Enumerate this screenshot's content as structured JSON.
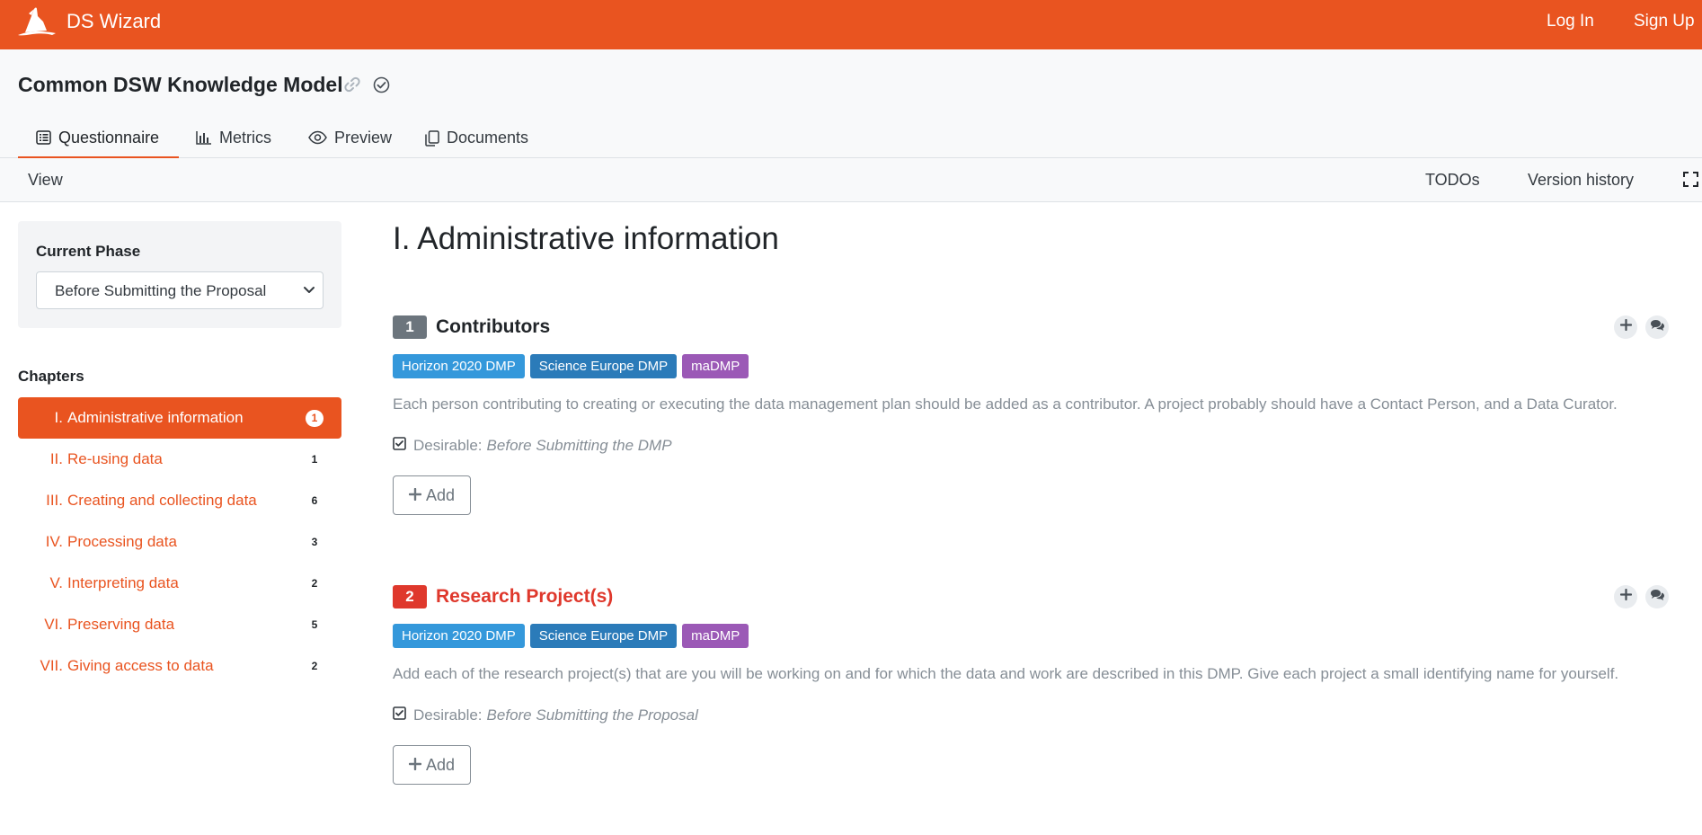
{
  "brand": {
    "name": "DS Wizard"
  },
  "nav": {
    "login": "Log In",
    "signup": "Sign Up"
  },
  "project": {
    "title": "Common DSW Knowledge Model"
  },
  "tabs": [
    {
      "label": "Questionnaire",
      "icon": "list-icon",
      "active": true
    },
    {
      "label": "Metrics",
      "icon": "bar-chart-icon"
    },
    {
      "label": "Preview",
      "icon": "eye-icon"
    },
    {
      "label": "Documents",
      "icon": "copy-icon"
    }
  ],
  "toolbar": {
    "view": "View",
    "todos": "TODOs",
    "version_history": "Version history",
    "fullscreen_icon": "expand-icon"
  },
  "phase": {
    "label": "Current Phase",
    "selected": "Before Submitting the Proposal"
  },
  "chapters": {
    "heading": "Chapters",
    "items": [
      {
        "num": "I.",
        "label": "Administrative information",
        "count": "1",
        "active": true
      },
      {
        "num": "II.",
        "label": "Re-using data",
        "count": "1"
      },
      {
        "num": "III.",
        "label": "Creating and collecting data",
        "count": "6"
      },
      {
        "num": "IV.",
        "label": "Processing data",
        "count": "3"
      },
      {
        "num": "V.",
        "label": "Interpreting data",
        "count": "2"
      },
      {
        "num": "VI.",
        "label": "Preserving data",
        "count": "5"
      },
      {
        "num": "VII.",
        "label": "Giving access to data",
        "count": "2"
      }
    ]
  },
  "main": {
    "chapter_title": "I. Administrative information",
    "questions": [
      {
        "num": "1",
        "title": "Contributors",
        "num_color": "#6c757d",
        "title_color": "#212529",
        "tags": [
          {
            "label": "Horizon 2020 DMP",
            "color": "#3498db"
          },
          {
            "label": "Science Europe DMP",
            "color": "#2b7bb9"
          },
          {
            "label": "maDMP",
            "color": "#9b59b6"
          }
        ],
        "description": "Each person contributing to creating or executing the data management plan should be added as a contributor. A project probably should have a Contact Person, and a Data Curator.",
        "desirable_label": "Desirable:",
        "desirable_value": "Before Submitting the DMP",
        "add_label": "Add"
      },
      {
        "num": "2",
        "title": "Research Project(s)",
        "num_color": "#df382c",
        "title_color": "#df382c",
        "tags": [
          {
            "label": "Horizon 2020 DMP",
            "color": "#3498db"
          },
          {
            "label": "Science Europe DMP",
            "color": "#2b7bb9"
          },
          {
            "label": "maDMP",
            "color": "#9b59b6"
          }
        ],
        "description": "Add each of the research project(s) that are you will be working on and for which the data and work are described in this DMP. Give each project a small identifying name for yourself.",
        "desirable_label": "Desirable:",
        "desirable_value": "Before Submitting the Proposal",
        "add_label": "Add"
      }
    ]
  },
  "colors": {
    "accent": "#e95420",
    "muted": "#868e96",
    "danger": "#df382c"
  }
}
